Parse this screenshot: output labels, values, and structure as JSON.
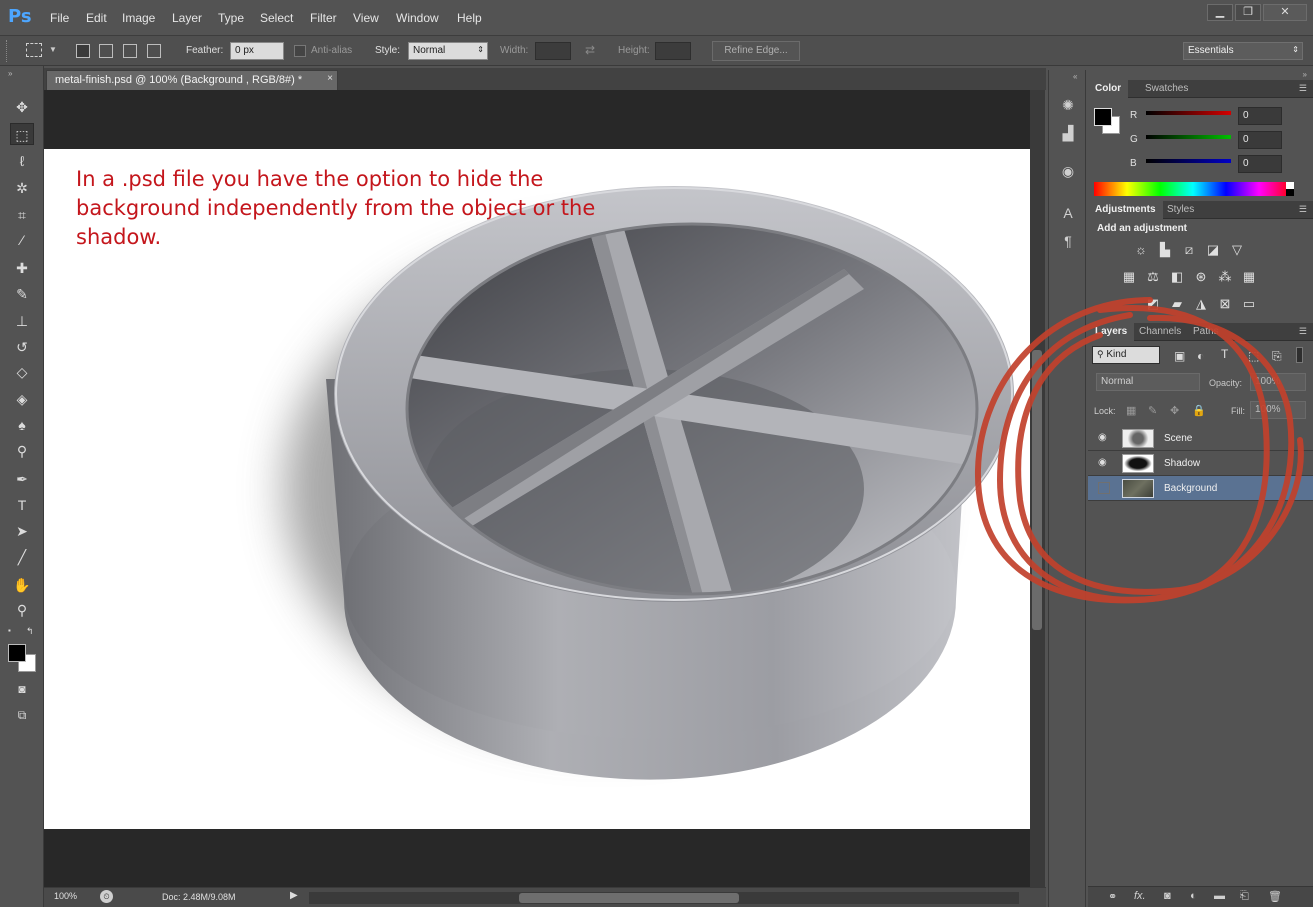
{
  "app": {
    "logo": "Ps"
  },
  "menu": [
    "File",
    "Edit",
    "Image",
    "Layer",
    "Type",
    "Select",
    "Filter",
    "View",
    "Window",
    "Help"
  ],
  "window_controls": {
    "minimize": "▁",
    "maximize": "❐",
    "close": "✕"
  },
  "options": {
    "feather_label": "Feather:",
    "feather_value": "0 px",
    "antialias_label": "Anti-alias",
    "style_label": "Style:",
    "style_value": "Normal",
    "width_label": "Width:",
    "height_label": "Height:",
    "refine_edge": "Refine Edge...",
    "workspace": "Essentials"
  },
  "document": {
    "tab_title": "metal-finish.psd @ 100% (Background , RGB/8#) *",
    "tab_close": "×",
    "annotation": "In a .psd file you have the option to hide the background independently from the object or the shadow."
  },
  "status": {
    "zoom": "100%",
    "doc": "Doc: 2.48M/9.08M"
  },
  "color_panel": {
    "tabs": [
      "Color",
      "Swatches"
    ],
    "channels": [
      {
        "label": "R",
        "value": "0",
        "color": "#d40000"
      },
      {
        "label": "G",
        "value": "0",
        "color": "#00c000"
      },
      {
        "label": "B",
        "value": "0",
        "color": "#0000c8"
      }
    ]
  },
  "adjustments_panel": {
    "tabs": [
      "Adjustments",
      "Styles"
    ],
    "heading": "Add an adjustment"
  },
  "layers_panel": {
    "tabs": [
      "Layers",
      "Channels",
      "Paths"
    ],
    "filter_kind": "Kind",
    "blend_mode": "Normal",
    "opacity_label": "Opacity:",
    "opacity_value": "100%",
    "lock_label": "Lock:",
    "fill_label": "Fill:",
    "fill_value": "100%",
    "layers": [
      {
        "name": "Scene",
        "visible": true,
        "selected": false
      },
      {
        "name": "Shadow",
        "visible": true,
        "selected": false
      },
      {
        "name": "Background",
        "visible": false,
        "selected": true
      }
    ],
    "footer_icons": [
      "link-icon",
      "fx-icon",
      "mask-icon",
      "adjustment-icon",
      "folder-icon",
      "new-layer-icon",
      "trash-icon"
    ]
  },
  "annotation_color": "#c4161c",
  "scribble_color": "#c2412c"
}
